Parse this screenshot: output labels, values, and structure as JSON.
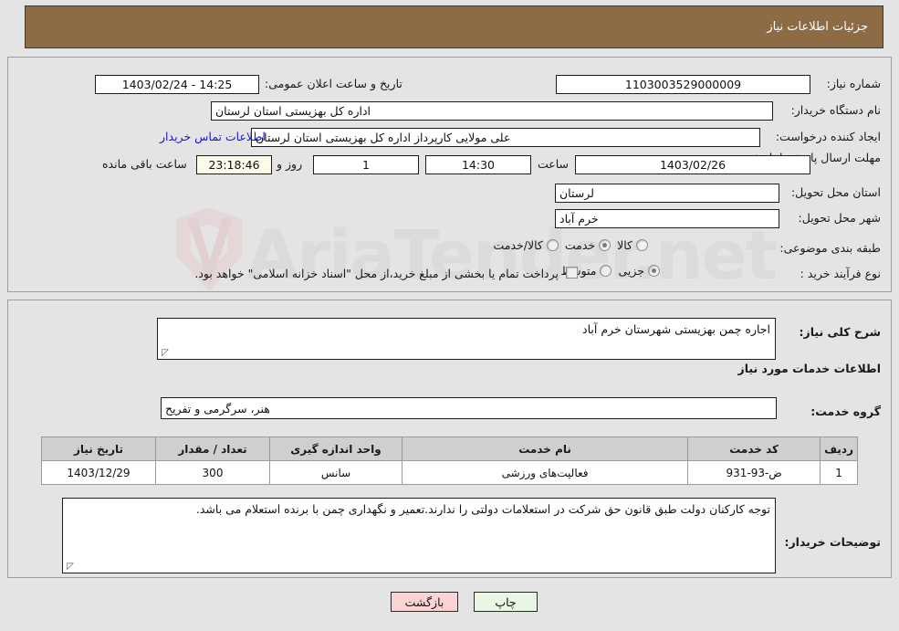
{
  "header": {
    "title": "جزئیات اطلاعات نیاز",
    "bg_color": "#8d6b45"
  },
  "watermark": {
    "text": "AriaTender.net"
  },
  "form": {
    "need_number_label": "شماره نیاز:",
    "need_number_value": "1103003529000009",
    "public_announce_label": "تاریخ و ساعت اعلان عمومی:",
    "public_announce_value": "14:25 - 1403/02/24",
    "buyer_org_label": "نام دستگاه خریدار:",
    "buyer_org_value": "اداره کل بهزیستی استان لرستان",
    "requester_label": "ایجاد کننده درخواست:",
    "requester_value": "علی مولایی کارپرداز اداره کل بهزیستی استان لرستان",
    "contact_link": "اطلاعات تماس خریدار",
    "deadline_label": "مهلت ارسال پاسخ: تا تاریخ:",
    "deadline_date": "1403/02/26",
    "deadline_hour_label": "ساعت",
    "deadline_time": "14:30",
    "remaining_days": "1",
    "remaining_days_label": "روز و",
    "remaining_clock": "23:18:46",
    "remaining_clock_label": "ساعت باقی مانده",
    "delivery_province_label": "استان محل تحویل:",
    "delivery_province_value": "لرستان",
    "delivery_city_label": "شهر محل تحویل:",
    "delivery_city_value": "خرم آباد",
    "category_label": "طبقه بندی موضوعی:",
    "category_options": [
      {
        "label": "کالا",
        "selected": false
      },
      {
        "label": "خدمت",
        "selected": true
      },
      {
        "label": "کالا/خدمت",
        "selected": false
      }
    ],
    "process_type_label": "نوع فرآیند خرید :",
    "process_type_options": [
      {
        "label": "جزیی",
        "selected": true
      },
      {
        "label": "متوسط",
        "selected": false
      }
    ],
    "treasury_checkbox_text": "پرداخت تمام یا بخشی از مبلغ خرید،از محل \"اسناد خزانه اسلامی\" خواهد بود.",
    "treasury_checked": false,
    "general_desc_label": "شرح کلی نیاز:",
    "general_desc_value": "اجاره چمن بهزیستی شهرستان خرم آباد",
    "services_section_title": "اطلاعات خدمات مورد نیاز",
    "service_group_label": "گروه خدمت:",
    "service_group_value": "هنر، سرگرمی و تفریح",
    "buyer_notes_label": "توضیحات خریدار:",
    "buyer_notes_value": "توجه کارکنان دولت طبق قانون حق شرکت در استعلامات دولتی را ندارند.تعمیر و نگهداری چمن با برنده استعلام می باشد."
  },
  "table": {
    "headers": [
      "ردیف",
      "کد خدمت",
      "نام خدمت",
      "واحد اندازه گیری",
      "تعداد / مقدار",
      "تاریخ نیاز"
    ],
    "rows": [
      {
        "row_no": "1",
        "service_code": "ض-93-931",
        "service_name": "فعالیت‌های ورزشی",
        "unit": "سانس",
        "quantity": "300",
        "need_date": "1403/12/29"
      }
    ]
  },
  "buttons": {
    "print": "چاپ",
    "back": "بازگشت"
  }
}
